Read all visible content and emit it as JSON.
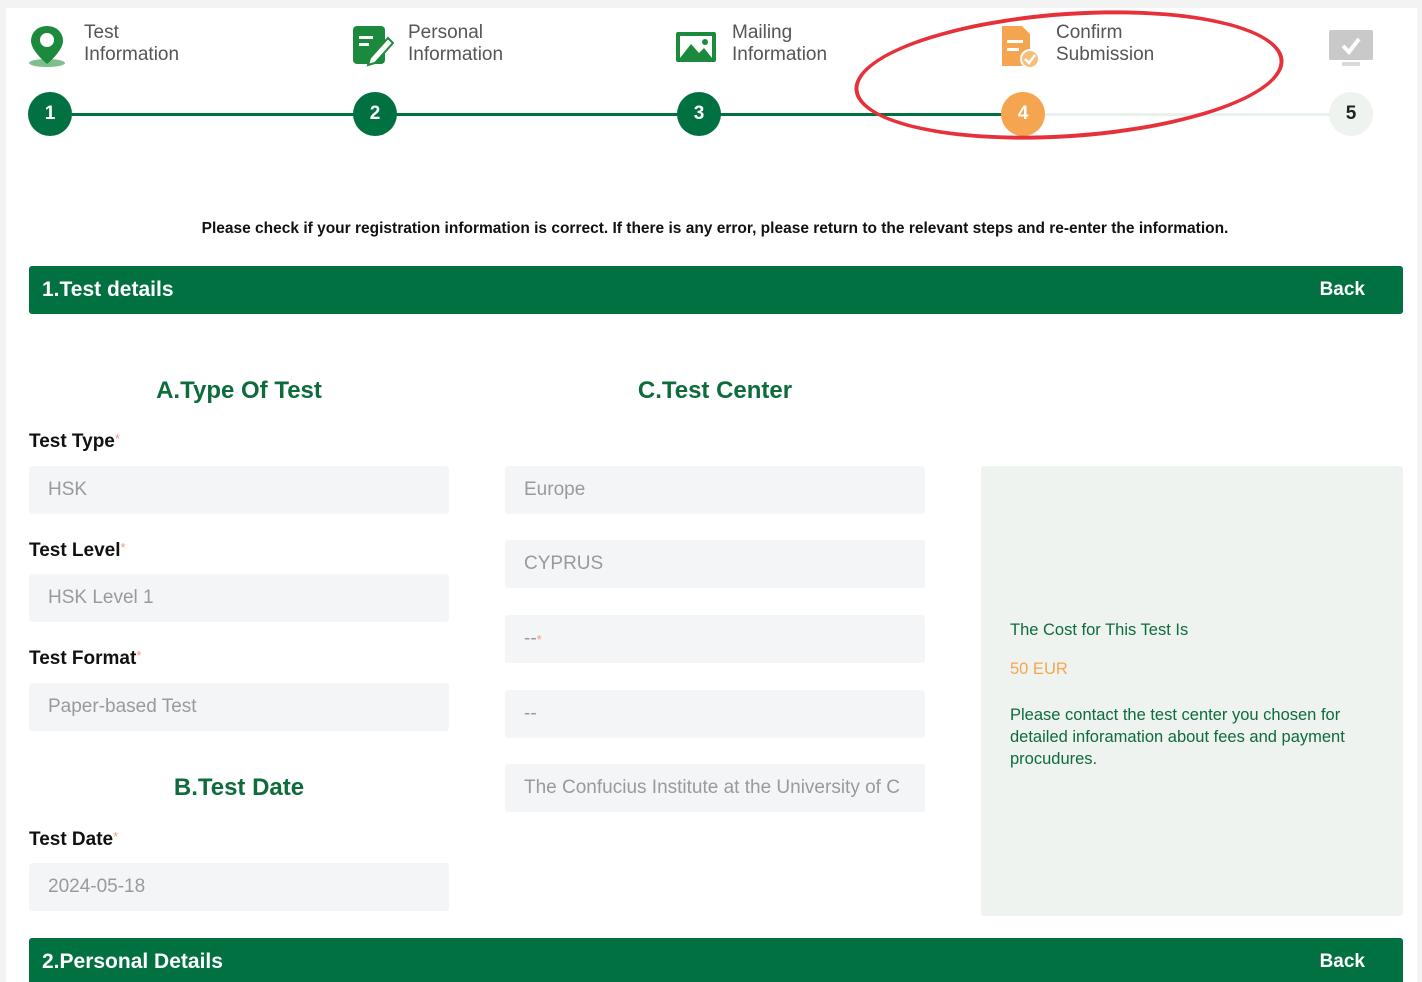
{
  "stepper": {
    "steps": [
      {
        "number": "1",
        "label": "Test\nInformation",
        "icon": "map-pin-icon",
        "state": "done"
      },
      {
        "number": "2",
        "label": "Personal\nInformation",
        "icon": "edit-document-icon",
        "state": "done"
      },
      {
        "number": "3",
        "label": "Mailing\nInformation",
        "icon": "photo-card-icon",
        "state": "done"
      },
      {
        "number": "4",
        "label": "Confirm\nSubmission",
        "icon": "document-check-icon",
        "state": "active"
      },
      {
        "number": "5",
        "label": "",
        "icon": "monitor-check-icon",
        "state": "pending"
      }
    ],
    "colors": {
      "done": "#027141",
      "active": "#f5a54f",
      "pending": "#eef3ef",
      "annotation": "#e6303a"
    }
  },
  "notice": "Please check if your registration information is correct. If there is any error, please return to the relevant steps and re-enter the information.",
  "section1": {
    "title": "1.Test details",
    "back_label": "Back",
    "type_of_test": {
      "heading": "A.Type Of Test",
      "test_type_label": "Test Type",
      "test_type_value": "HSK",
      "test_level_label": "Test Level",
      "test_level_value": "HSK Level 1",
      "test_format_label": "Test Format",
      "test_format_value": "Paper-based Test"
    },
    "test_date": {
      "heading": "B.Test Date",
      "label": "Test Date",
      "value": "2024-05-18"
    },
    "test_center": {
      "heading": "C.Test Center",
      "region": "Europe",
      "country": "CYPRUS",
      "city": "--",
      "district": "--",
      "institute": "The Confucius Institute at the University of C"
    },
    "required_mark": "*",
    "cost": {
      "title": "The Cost for This Test Is",
      "amount": "50 EUR",
      "note": "Please contact the test center you chosen for detailed inforamation about fees and payment procudures."
    }
  },
  "section2": {
    "title": "2.Personal Details",
    "back_label": "Back"
  }
}
